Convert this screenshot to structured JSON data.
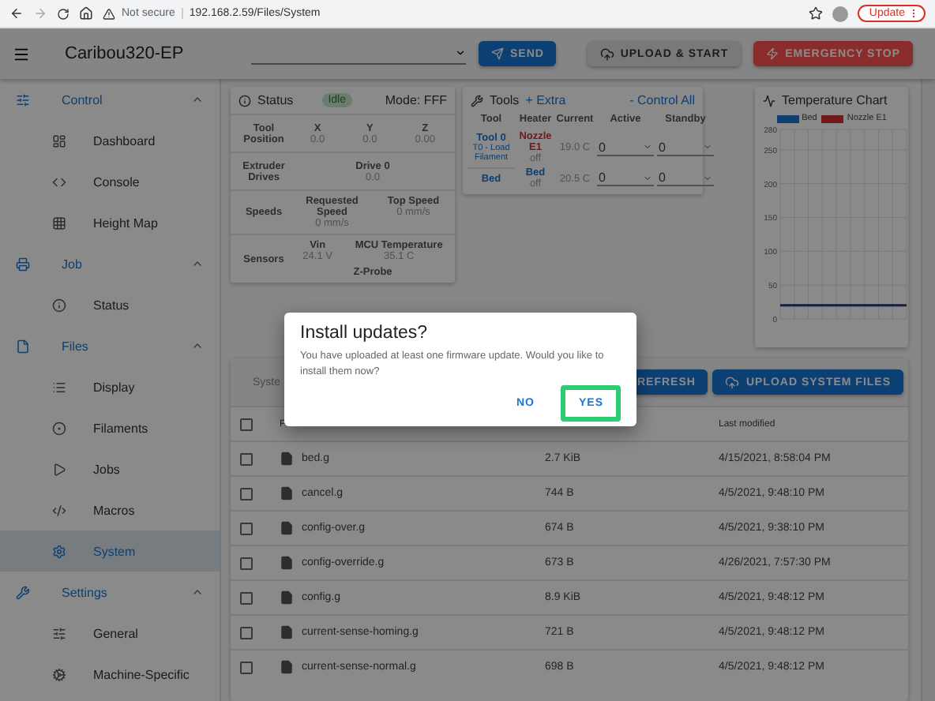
{
  "browser": {
    "security": "Not secure",
    "url": "192.168.2.59/Files/System",
    "update": "Update"
  },
  "appbar": {
    "title": "Caribou320-EP",
    "send": "SEND",
    "upload_start": "UPLOAD & START",
    "emergency": "EMERGENCY STOP"
  },
  "sidebar": [
    {
      "title": "Control",
      "expanded": true,
      "items": [
        {
          "label": "Dashboard",
          "selected": false
        },
        {
          "label": "Console",
          "selected": false
        },
        {
          "label": "Height Map",
          "selected": false
        }
      ]
    },
    {
      "title": "Job",
      "expanded": true,
      "items": [
        {
          "label": "Status",
          "selected": false
        }
      ]
    },
    {
      "title": "Files",
      "expanded": true,
      "items": [
        {
          "label": "Display",
          "selected": false
        },
        {
          "label": "Filaments",
          "selected": false
        },
        {
          "label": "Jobs",
          "selected": false
        },
        {
          "label": "Macros",
          "selected": false
        },
        {
          "label": "System",
          "selected": true
        }
      ]
    },
    {
      "title": "Settings",
      "expanded": true,
      "items": [
        {
          "label": "General",
          "selected": false
        },
        {
          "label": "Machine-Specific",
          "selected": false
        }
      ]
    }
  ],
  "status": {
    "title": "Status",
    "state": "Idle",
    "mode": "Mode: FFF",
    "position": {
      "label": "Tool Position",
      "axes": [
        {
          "name": "X",
          "value": "0.0"
        },
        {
          "name": "Y",
          "value": "0.0"
        },
        {
          "name": "Z",
          "value": "0.00"
        }
      ]
    },
    "extruder": {
      "label": "Extruder Drives",
      "drives": [
        {
          "name": "Drive 0",
          "value": "0.0"
        }
      ]
    },
    "speeds": {
      "label": "Speeds",
      "items": [
        {
          "name": "Requested Speed",
          "value": "0 mm/s"
        },
        {
          "name": "Top Speed",
          "value": "0 mm/s"
        }
      ]
    },
    "sensors": {
      "label": "Sensors",
      "items": [
        {
          "name": "Vin",
          "value": "24.1 V"
        },
        {
          "name": "MCU Temperature",
          "value": "35.1 C"
        },
        {
          "name": "Z-Probe",
          "value": ""
        }
      ]
    }
  },
  "tools": {
    "title": "Tools",
    "extra": "+ Extra",
    "control_all": "- Control All",
    "columns": [
      "Tool",
      "Heater",
      "Current",
      "Active",
      "Standby"
    ],
    "rows": [
      {
        "tool": "Tool 0",
        "sub": "T0 - Load Filament",
        "heater": "Nozzle",
        "heater_name": "E1",
        "heater_state": "off",
        "current": "19.0 C",
        "active": "0",
        "standby": "0"
      },
      {
        "tool": "Bed",
        "sub": "",
        "heater": "Bed",
        "heater_name": "",
        "heater_state": "off",
        "current": "20.5 C",
        "active": "0",
        "standby": "0"
      }
    ]
  },
  "temperature_chart": {
    "title": "Temperature Chart",
    "legend": [
      {
        "name": "Bed",
        "color": "#0e4071"
      },
      {
        "name": "Nozzle E1",
        "color": "#721919"
      }
    ],
    "y_axis_labels": [
      "280",
      "250",
      "200",
      "150",
      "100",
      "50",
      "0"
    ]
  },
  "files": {
    "path": "Syste",
    "refresh": "REFRESH",
    "upload": "UPLOAD SYSTEM FILES",
    "select_all_checked": false,
    "columns": [
      "F",
      "Last modified"
    ],
    "rows": [
      {
        "name": "bed.g",
        "size": "2.7 KiB",
        "modified": "4/15/2021, 8:58:04 PM",
        "checked": false
      },
      {
        "name": "cancel.g",
        "size": "744 B",
        "modified": "4/5/2021, 9:48:10 PM",
        "checked": false
      },
      {
        "name": "config-over.g",
        "size": "674 B",
        "modified": "4/5/2021, 9:38:10 PM",
        "checked": false
      },
      {
        "name": "config-override.g",
        "size": "673 B",
        "modified": "4/26/2021, 7:57:30 PM",
        "checked": false
      },
      {
        "name": "config.g",
        "size": "8.9 KiB",
        "modified": "4/5/2021, 9:48:12 PM",
        "checked": false
      },
      {
        "name": "current-sense-homing.g",
        "size": "721 B",
        "modified": "4/5/2021, 9:48:12 PM",
        "checked": false
      },
      {
        "name": "current-sense-normal.g",
        "size": "698 B",
        "modified": "4/5/2021, 9:48:12 PM",
        "checked": false
      }
    ]
  },
  "dialog": {
    "title": "Install updates?",
    "message": "You have uploaded at least one firmware update. Would you like to install them now?",
    "buttons": [
      {
        "label": "NO",
        "highlighted": false
      },
      {
        "label": "YES",
        "highlighted": true
      }
    ]
  }
}
